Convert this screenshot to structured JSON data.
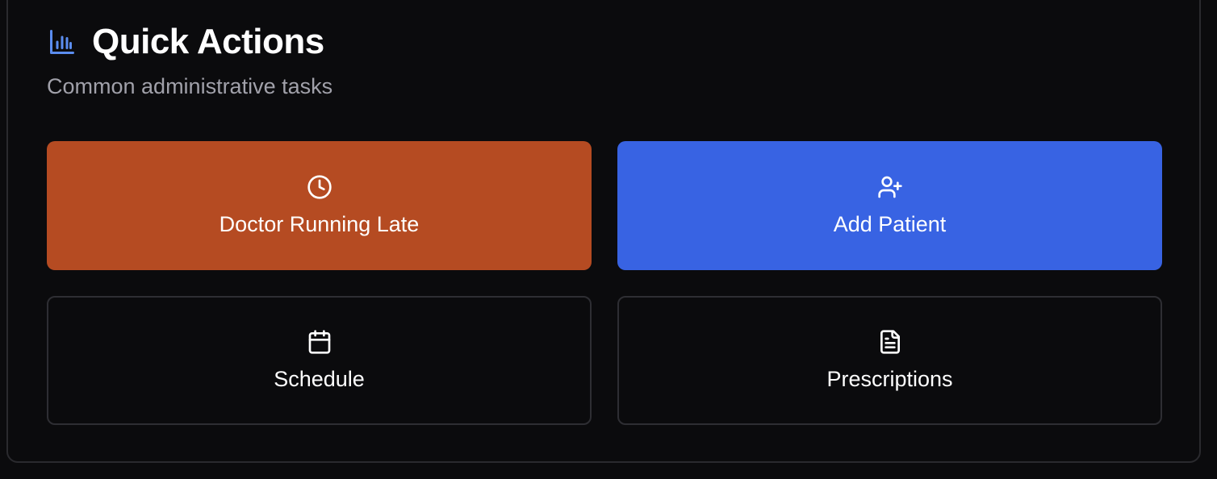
{
  "panel": {
    "title": "Quick Actions",
    "subtitle": "Common administrative tasks",
    "title_icon": "bar-chart-icon",
    "accent_color": "#5b8def"
  },
  "actions": [
    {
      "label": "Doctor Running Late",
      "icon": "clock-icon",
      "color": "#b54b22"
    },
    {
      "label": "Add Patient",
      "icon": "user-plus-icon",
      "color": "#3863e3"
    },
    {
      "label": "Schedule",
      "icon": "calendar-icon",
      "color": "#0b0b0d"
    },
    {
      "label": "Prescriptions",
      "icon": "file-text-icon",
      "color": "#0b0b0d"
    }
  ]
}
